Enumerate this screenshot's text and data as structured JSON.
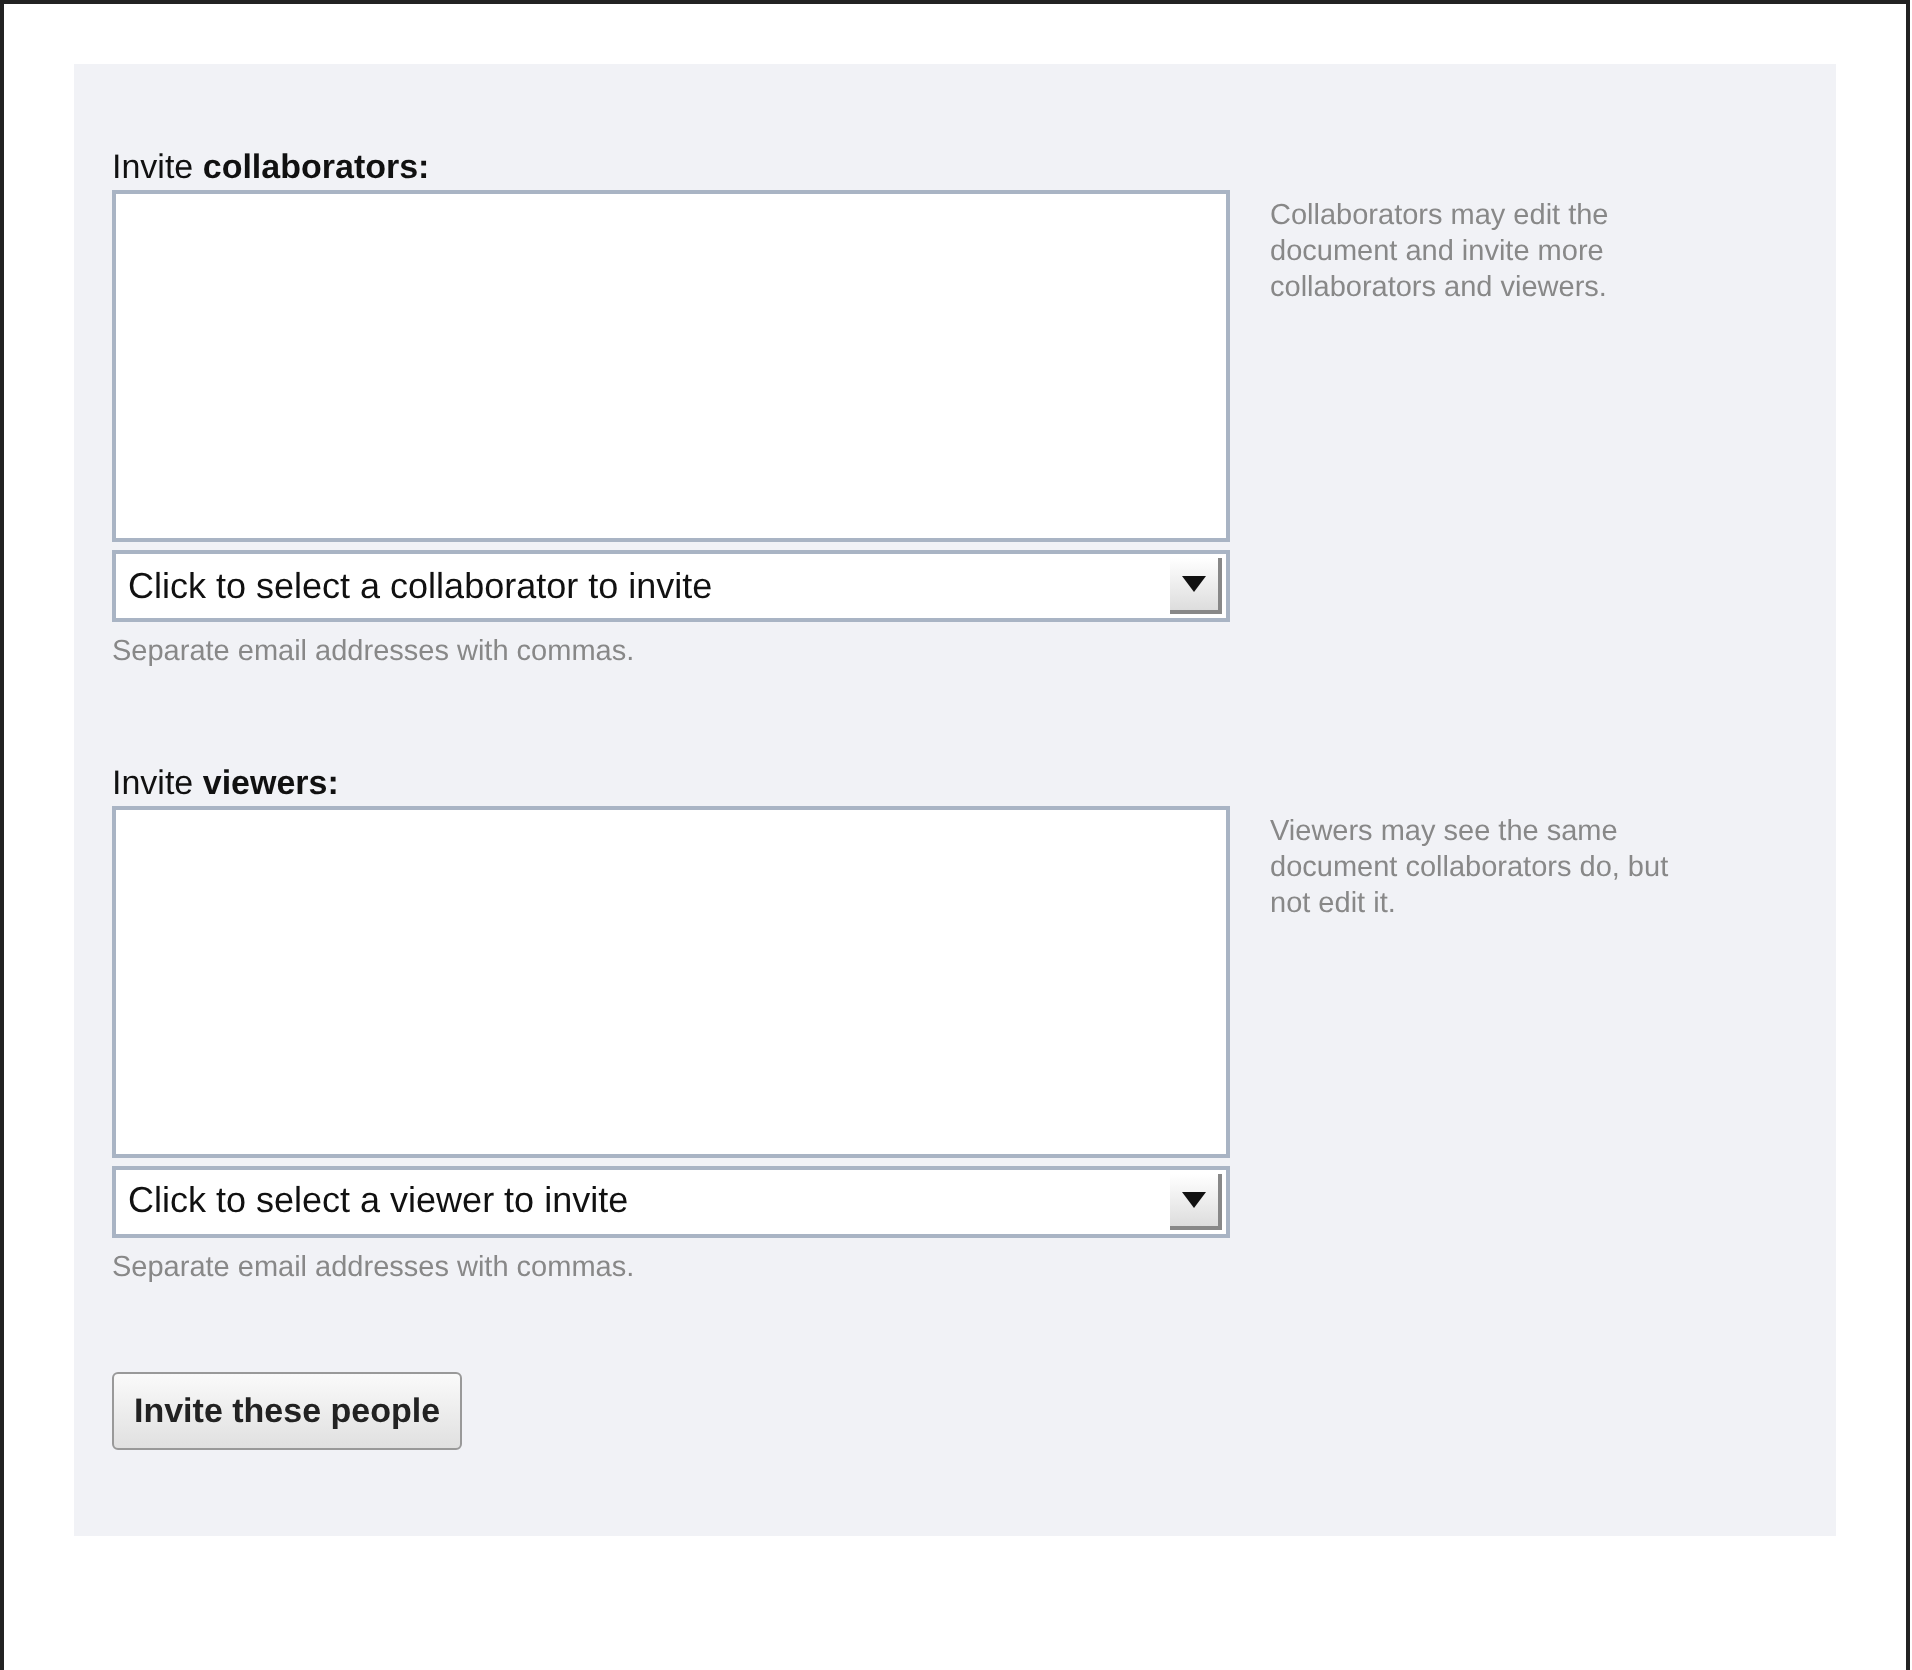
{
  "sections": [
    {
      "label": "Invite **collaborators:**",
      "dropdown": {
        "value": "Click to select a collaborator to invite"
      },
      "hint": "Separate email addresses with commas.",
      "description": "Collaborators may edit the document and invite more collaborators and viewers."
    },
    {
      "label": "Invite **viewers:**",
      "dropdown": {
        "value": "Click to select a viewer to invite"
      },
      "hint": "Separate email addresses with commas.",
      "description": "Viewers may see the same document collaborators do, but not edit it."
    }
  ],
  "submit_button": "Invite these people"
}
